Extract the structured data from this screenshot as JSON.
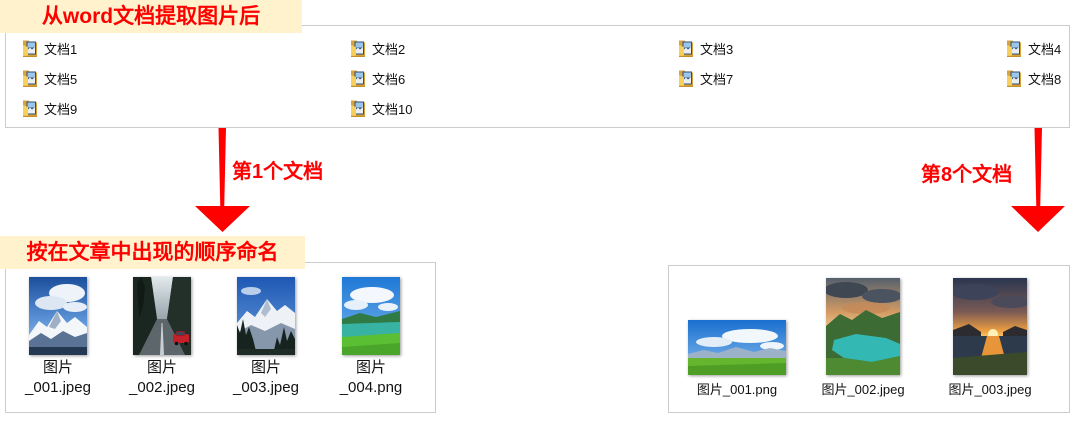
{
  "colors": {
    "annotation_red": "#FF0000",
    "label_background": "#FFF2CC",
    "panel_border": "#CCCCCC"
  },
  "annotations": {
    "source_label": "从word文档提取图片后",
    "doc1_arrow_label": "第1个文档",
    "doc8_arrow_label": "第8个文档",
    "naming_label": "按在文章中出现的顺序命名"
  },
  "documents_view": {
    "items": [
      {
        "name": "文档1",
        "icon": "picture-folder-icon"
      },
      {
        "name": "文档2",
        "icon": "picture-folder-icon"
      },
      {
        "name": "文档3",
        "icon": "picture-folder-icon"
      },
      {
        "name": "文档4",
        "icon": "picture-folder-icon"
      },
      {
        "name": "文档5",
        "icon": "picture-folder-icon"
      },
      {
        "name": "文档6",
        "icon": "picture-folder-icon"
      },
      {
        "name": "文档7",
        "icon": "picture-folder-icon"
      },
      {
        "name": "文档8",
        "icon": "picture-folder-icon"
      },
      {
        "name": "文档9",
        "icon": "picture-folder-icon"
      },
      {
        "name": "文档10",
        "icon": "picture-folder-icon"
      }
    ]
  },
  "doc1_images_view": {
    "items": [
      {
        "filename": "图片_001.jpeg"
      },
      {
        "filename": "图片_002.jpeg"
      },
      {
        "filename": "图片_003.jpeg"
      },
      {
        "filename": "图片_004.png"
      }
    ]
  },
  "doc8_images_view": {
    "items": [
      {
        "filename": "图片_001.png"
      },
      {
        "filename": "图片_002.jpeg"
      },
      {
        "filename": "图片_003.jpeg"
      }
    ]
  }
}
